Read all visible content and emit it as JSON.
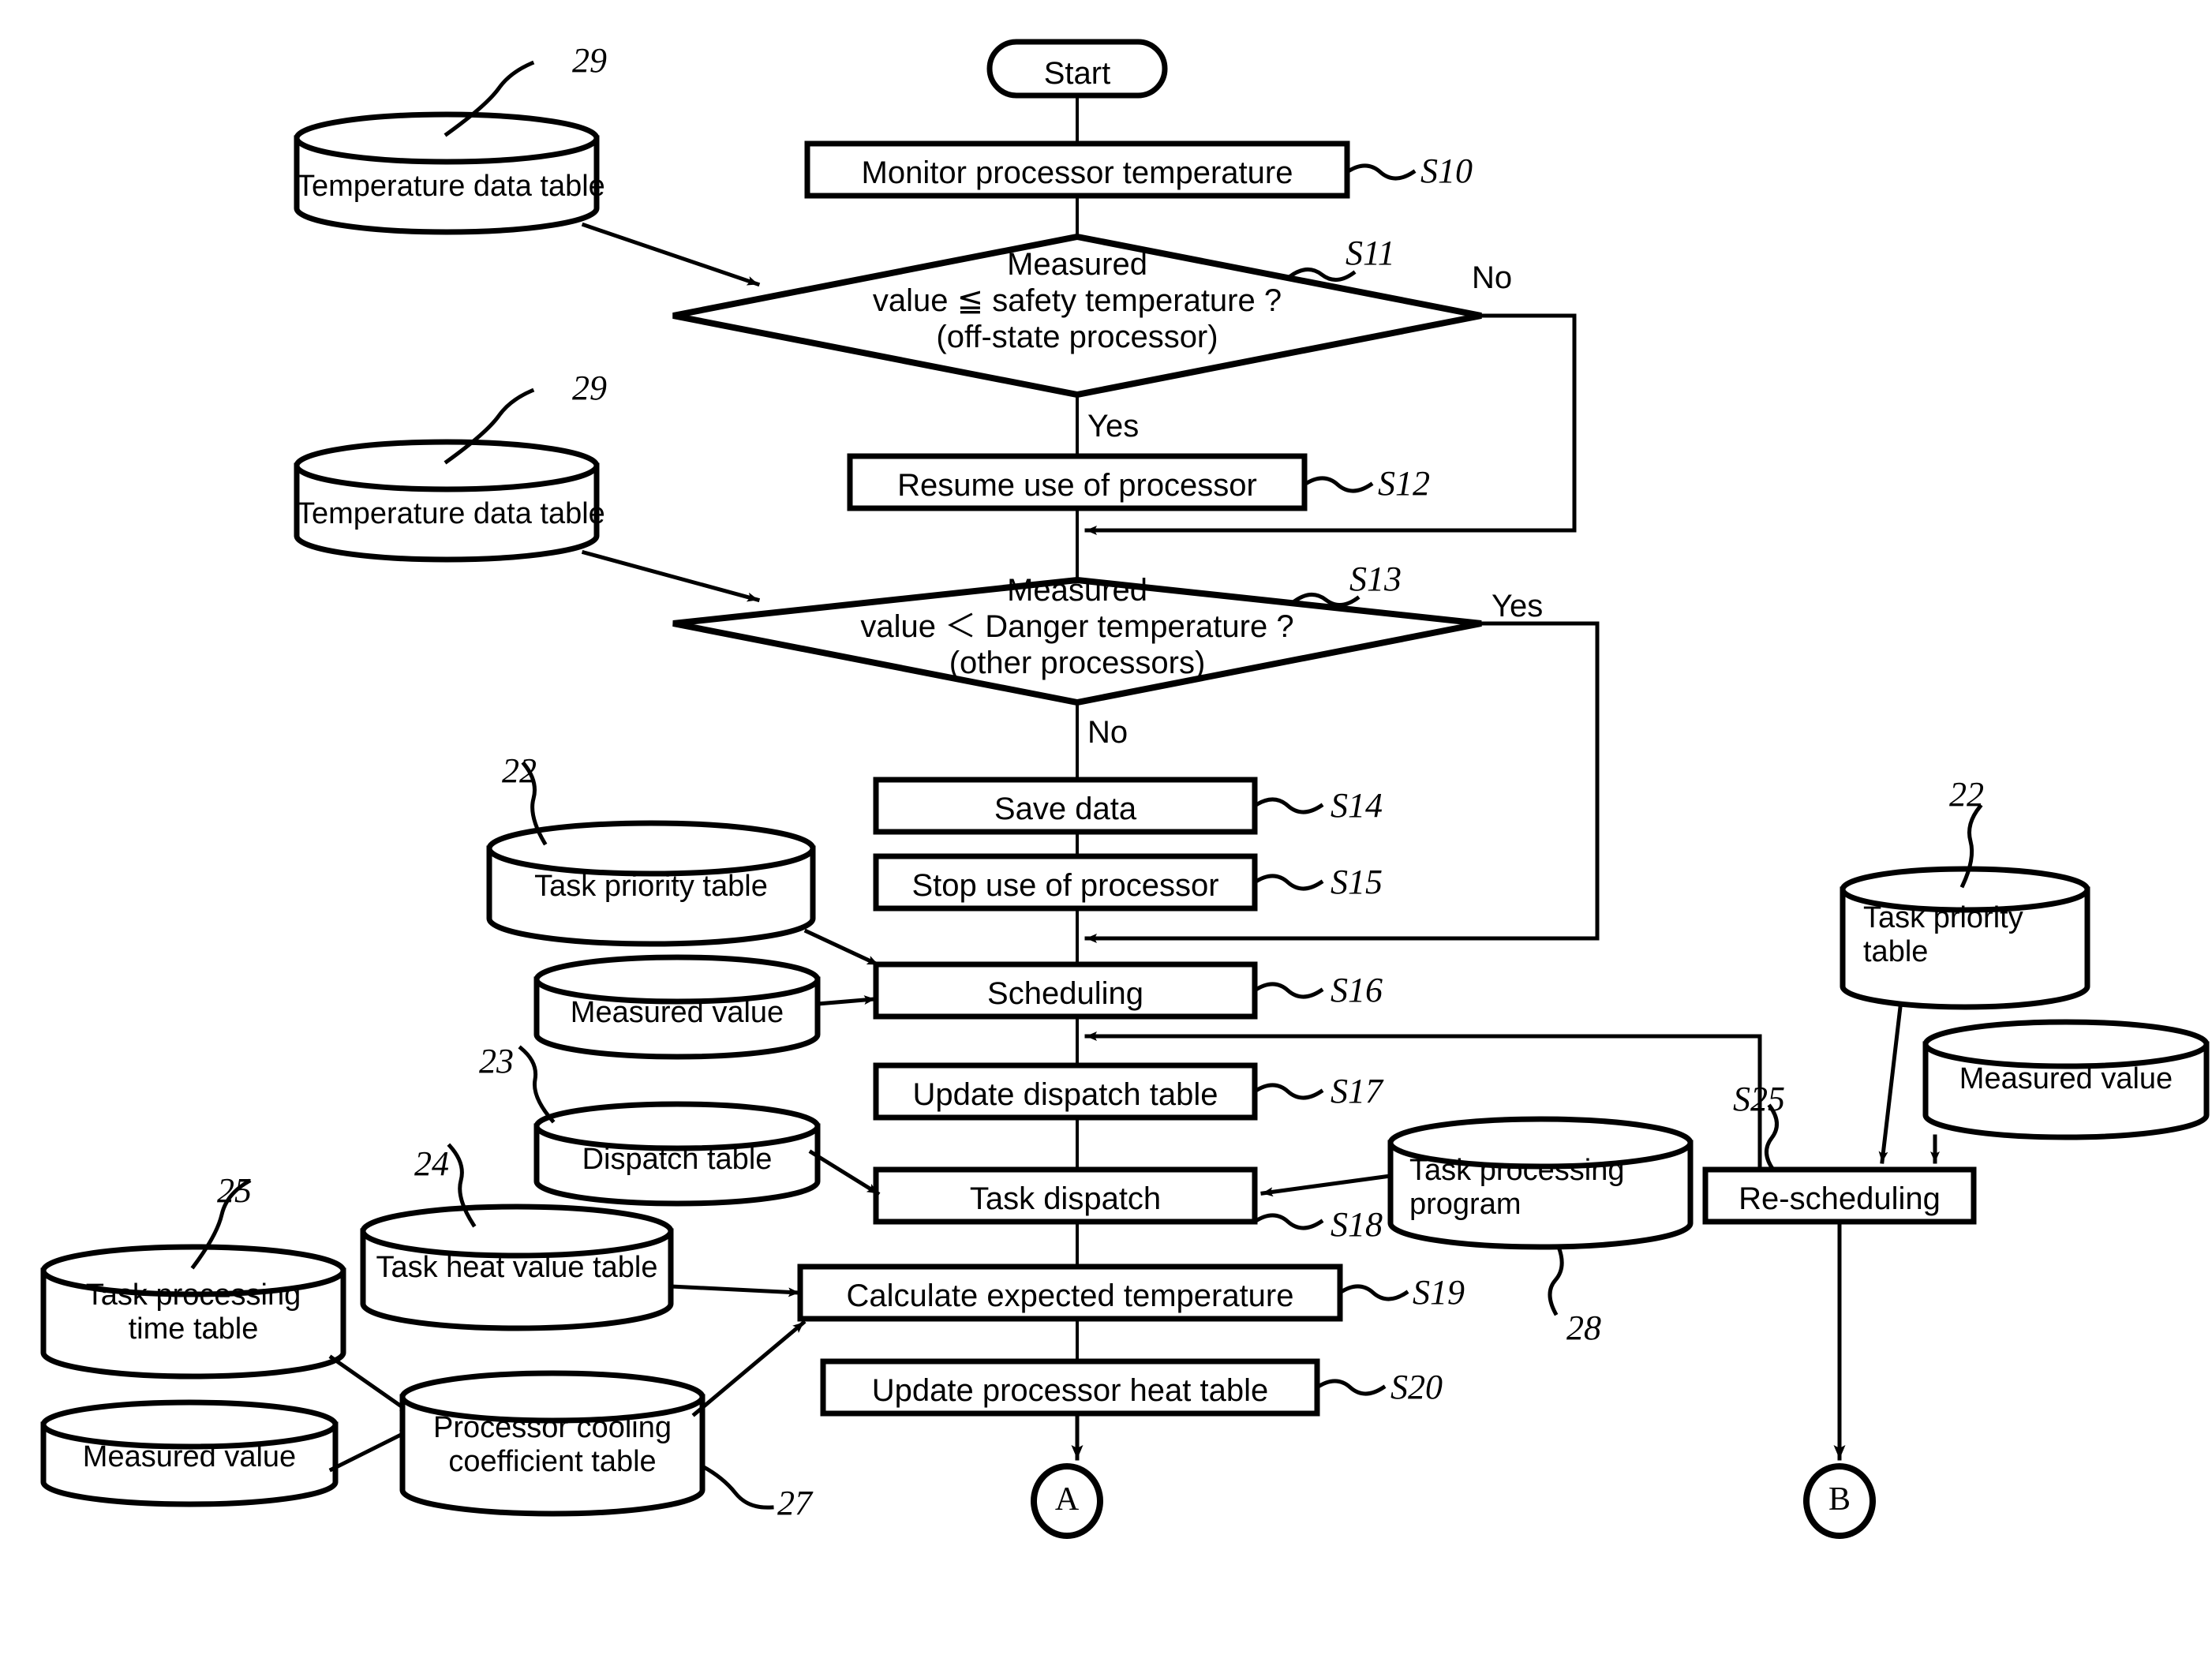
{
  "figure": {
    "type": "patent-flowchart",
    "terminators": {
      "start": "Start",
      "connector_a": "A",
      "connector_b": "B"
    },
    "process_steps": [
      {
        "id": "S10",
        "label": "Monitor processor temperature",
        "step_ref": "S10"
      },
      {
        "id": "S12",
        "label": "Resume use of processor",
        "step_ref": "S12"
      },
      {
        "id": "S14",
        "label": "Save data",
        "step_ref": "S14"
      },
      {
        "id": "S15",
        "label": "Stop use of processor",
        "step_ref": "S15"
      },
      {
        "id": "S16",
        "label": "Scheduling",
        "step_ref": "S16"
      },
      {
        "id": "S17",
        "label": "Update dispatch table",
        "step_ref": "S17"
      },
      {
        "id": "S18",
        "label": "Task dispatch",
        "step_ref": "S18"
      },
      {
        "id": "S19",
        "label": "Calculate expected temperature",
        "step_ref": "S19"
      },
      {
        "id": "S20",
        "label": "Update processor heat table",
        "step_ref": "S20"
      },
      {
        "id": "S25",
        "label": "Re-scheduling",
        "step_ref": "S25"
      }
    ],
    "decisions": [
      {
        "id": "S11",
        "step_ref": "S11",
        "line1": "Measured",
        "line2": "value ≦ safety temperature ?",
        "line3": "(off-state processor)",
        "yes_label": "Yes",
        "no_label": "No"
      },
      {
        "id": "S13",
        "step_ref": "S13",
        "line1": "Measured",
        "line2": "value ＜ Danger temperature ?",
        "line3": "(other processors)",
        "yes_label": "Yes",
        "no_label": "No"
      }
    ],
    "data_stores": [
      {
        "id": "ds-temp-1",
        "label": "Temperature data table",
        "ref": "29"
      },
      {
        "id": "ds-temp-2",
        "label": "Temperature data table",
        "ref": "29"
      },
      {
        "id": "ds-task-prio-1",
        "label": "Task priority table",
        "ref": "22"
      },
      {
        "id": "ds-measured-1",
        "label": "Measured value",
        "ref": ""
      },
      {
        "id": "ds-dispatch",
        "label": "Dispatch table",
        "ref": "23"
      },
      {
        "id": "ds-heat-value",
        "label": "Task heat value table",
        "ref": "24"
      },
      {
        "id": "ds-proc-time",
        "label": "Task processing\ntime table",
        "ref": "25"
      },
      {
        "id": "ds-measured-2",
        "label": "Measured value",
        "ref": ""
      },
      {
        "id": "ds-cooling",
        "label": "Processor cooling\ncoefficient table",
        "ref": "27"
      },
      {
        "id": "ds-task-prog",
        "label": "Task processing\nprogram",
        "ref": "28"
      },
      {
        "id": "ds-task-prio-2",
        "label": "Task priority\ntable",
        "ref": "22"
      },
      {
        "id": "ds-measured-3",
        "label": "Measured value",
        "ref": ""
      }
    ],
    "reference_numerals": [
      "29",
      "29",
      "22",
      "23",
      "24",
      "25",
      "27",
      "28",
      "22"
    ],
    "colors": {
      "stroke": "#000000",
      "fill": "#ffffff",
      "background": "#ffffff"
    }
  }
}
